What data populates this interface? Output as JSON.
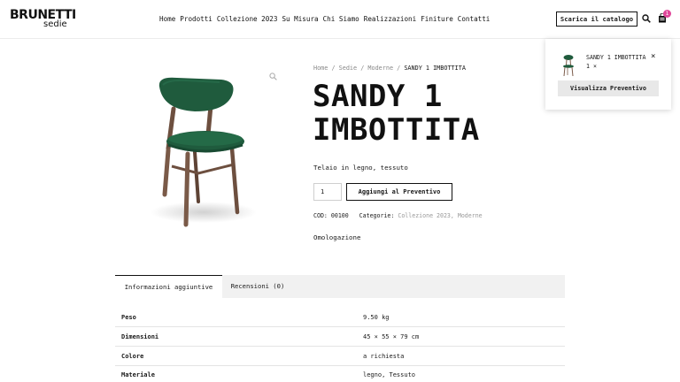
{
  "header": {
    "logo_main": "BRUNETTI",
    "logo_sub": "sedie",
    "nav": [
      "Home",
      "Prodotti",
      "Collezione 2023",
      "Su Misura",
      "Chi Siamo",
      "Realizzazioni",
      "Finiture",
      "Contatti"
    ],
    "catalog_button": "Scarica il catalogo",
    "cart_count": "1",
    "icons": {
      "search": "search-icon",
      "cart": "cart-icon"
    },
    "badge_color": "#e0469a"
  },
  "minicart": {
    "item_name": "SANDY 1 IMBOTTITA",
    "item_qty": "1 ×",
    "remove": "×",
    "button": "Visualizza Preventivo"
  },
  "breadcrumb": {
    "items": [
      "Home",
      "Sedie",
      "Moderne"
    ],
    "separator": "/",
    "current": "SANDY 1 IMBOTTITA"
  },
  "product": {
    "title_line1": "SANDY 1",
    "title_line2": "IMBOTTITA",
    "short_description": "Telaio in legno, tessuto",
    "quantity": "1",
    "add_button": "Aggiungi al Preventivo",
    "sku_label": "COD:",
    "sku": "00100",
    "categories_label": "Categorie:",
    "categories": [
      "Collezione 2023",
      "Moderne"
    ],
    "omologazione": "Omologazione",
    "seat_color": "#1f5b3d",
    "frame_color": "#7a5a48"
  },
  "tabs": {
    "info": "Informazioni aggiuntive",
    "reviews": "Recensioni (0)"
  },
  "attributes": [
    {
      "label": "Peso",
      "value": "9.50 kg"
    },
    {
      "label": "Dimensioni",
      "value": "45 × 55 × 79 cm"
    },
    {
      "label": "Colore",
      "value": "a richiesta"
    },
    {
      "label": "Materiale",
      "value": "legno, Tessuto"
    }
  ]
}
